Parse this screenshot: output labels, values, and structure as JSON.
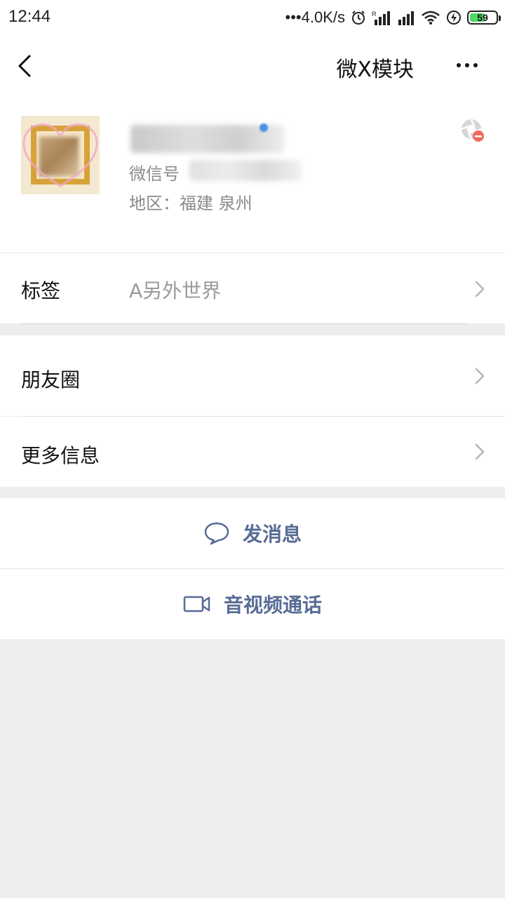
{
  "status_bar": {
    "time": "12:44",
    "network_speed": "•••4.0K/s",
    "battery_level": 59,
    "battery_text": "59",
    "icons": [
      "alarm-icon",
      "signal-r-icon",
      "signal-icon",
      "wifi-icon",
      "charging-icon",
      "battery-icon"
    ]
  },
  "nav": {
    "title": "微X模块",
    "back_icon": "chevron-left-icon",
    "more_icon": "more-dots-icon"
  },
  "profile": {
    "wechat_id_label": "微信号",
    "region": "地区：福建  泉州",
    "moments_blocked_icon": "camera-shutter-blocked-icon"
  },
  "rows": {
    "tag": {
      "label": "标签",
      "value": "A另外世界"
    },
    "moments": {
      "label": "朋友圈"
    },
    "more_info": {
      "label": "更多信息"
    }
  },
  "actions": {
    "send_message": {
      "label": "发消息",
      "icon": "chat-bubble-icon"
    },
    "video_call": {
      "label": "音视频通话",
      "icon": "video-camera-icon"
    }
  },
  "colors": {
    "action_text": "#576b95",
    "page_background": "#ededed",
    "battery_fill": "#4cd964"
  }
}
